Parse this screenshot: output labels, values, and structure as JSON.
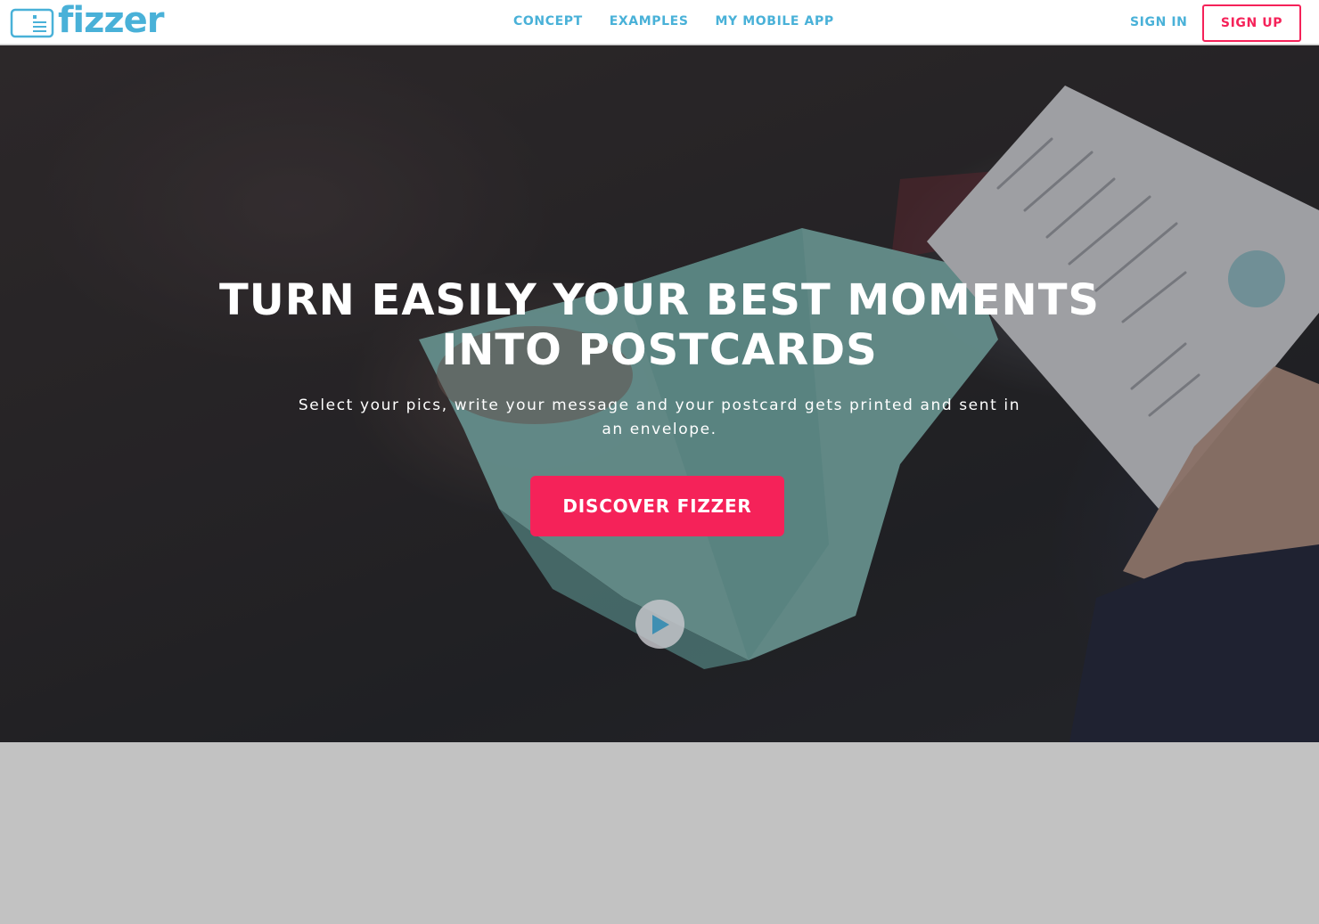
{
  "header": {
    "logo_text": "fizzer",
    "nav": [
      {
        "label": "CONCEPT"
      },
      {
        "label": "EXAMPLES"
      },
      {
        "label": "MY MOBILE APP"
      }
    ],
    "sign_in": "SIGN IN",
    "sign_up": "SIGN UP"
  },
  "hero": {
    "title_line1": "TURN EASILY YOUR BEST MOMENTS",
    "title_line2": "INTO POSTCARDS",
    "subtitle": "Select your pics, write your message and your postcard gets printed and sent in an envelope.",
    "cta_label": "DISCOVER FIZZER",
    "play_icon": "play-icon"
  },
  "colors": {
    "brand_blue": "#49b1d8",
    "accent_pink": "#f52259",
    "lower_bg": "#c2c2c2"
  }
}
